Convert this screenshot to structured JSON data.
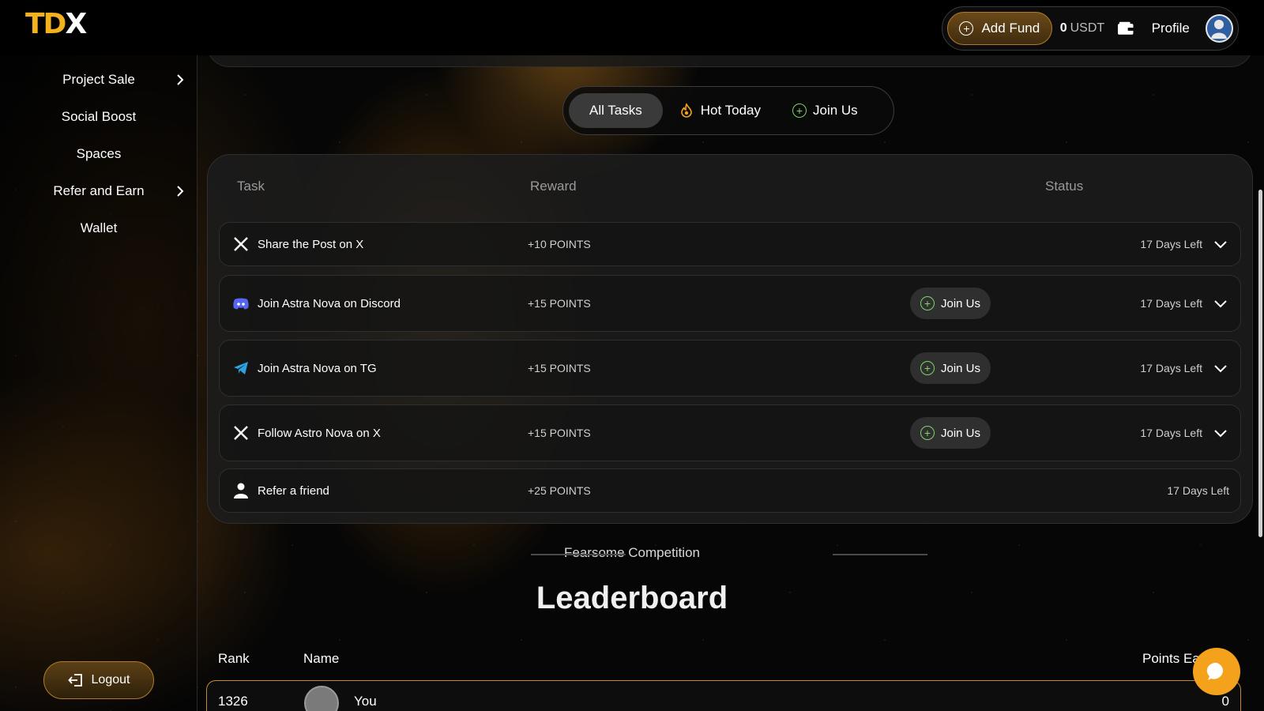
{
  "header": {
    "logo_part1": "TD",
    "logo_part2": "X",
    "add_fund_label": "Add Fund",
    "balance_value": "0",
    "balance_currency": "USDT",
    "profile_label": "Profile"
  },
  "sidebar": {
    "items": [
      {
        "label": "Project Sale",
        "has_chevron": true
      },
      {
        "label": "Social Boost",
        "has_chevron": false
      },
      {
        "label": "Spaces",
        "has_chevron": false
      },
      {
        "label": "Refer and Earn",
        "has_chevron": true
      },
      {
        "label": "Wallet",
        "has_chevron": false
      }
    ],
    "logout_label": "Logout"
  },
  "tabs": [
    {
      "label": "All Tasks",
      "active": true
    },
    {
      "label": "Hot Today",
      "active": false
    },
    {
      "label": "Join Us",
      "active": false
    }
  ],
  "tasks": {
    "columns": {
      "task": "Task",
      "reward": "Reward",
      "status": "Status"
    },
    "join_label": "Join Us",
    "rows": [
      {
        "platform": "x-icon",
        "name": "Share the Post on X",
        "reward": "+10 POINTS",
        "status": "17 Days Left",
        "join": false
      },
      {
        "platform": "discord-icon",
        "name": "Join Astra Nova on Discord",
        "reward": "+15 POINTS",
        "status": "17 Days Left",
        "join": true
      },
      {
        "platform": "telegram-icon",
        "name": "Join Astra Nova on TG",
        "reward": "+15 POINTS",
        "status": "17 Days Left",
        "join": true
      },
      {
        "platform": "x-icon",
        "name": "Follow Astro Nova on X",
        "reward": "+15 POINTS",
        "status": "17 Days Left",
        "join": true
      },
      {
        "platform": "user-icon",
        "name": "Refer a friend",
        "reward": "+25 POINTS",
        "status": "17 Days Left",
        "join": false
      }
    ]
  },
  "leaderboard": {
    "subtitle": "Fearsome Competition",
    "title": "Leaderboard",
    "columns": {
      "rank": "Rank",
      "name": "Name",
      "points": "Points Ea"
    },
    "rows": [
      {
        "rank": "1326",
        "name": "You",
        "points": "0"
      }
    ]
  },
  "colors": {
    "accent": "#f4a21b",
    "join_green": "#7fd36a",
    "discord": "#5865f2",
    "telegram": "#2aa3e0"
  }
}
